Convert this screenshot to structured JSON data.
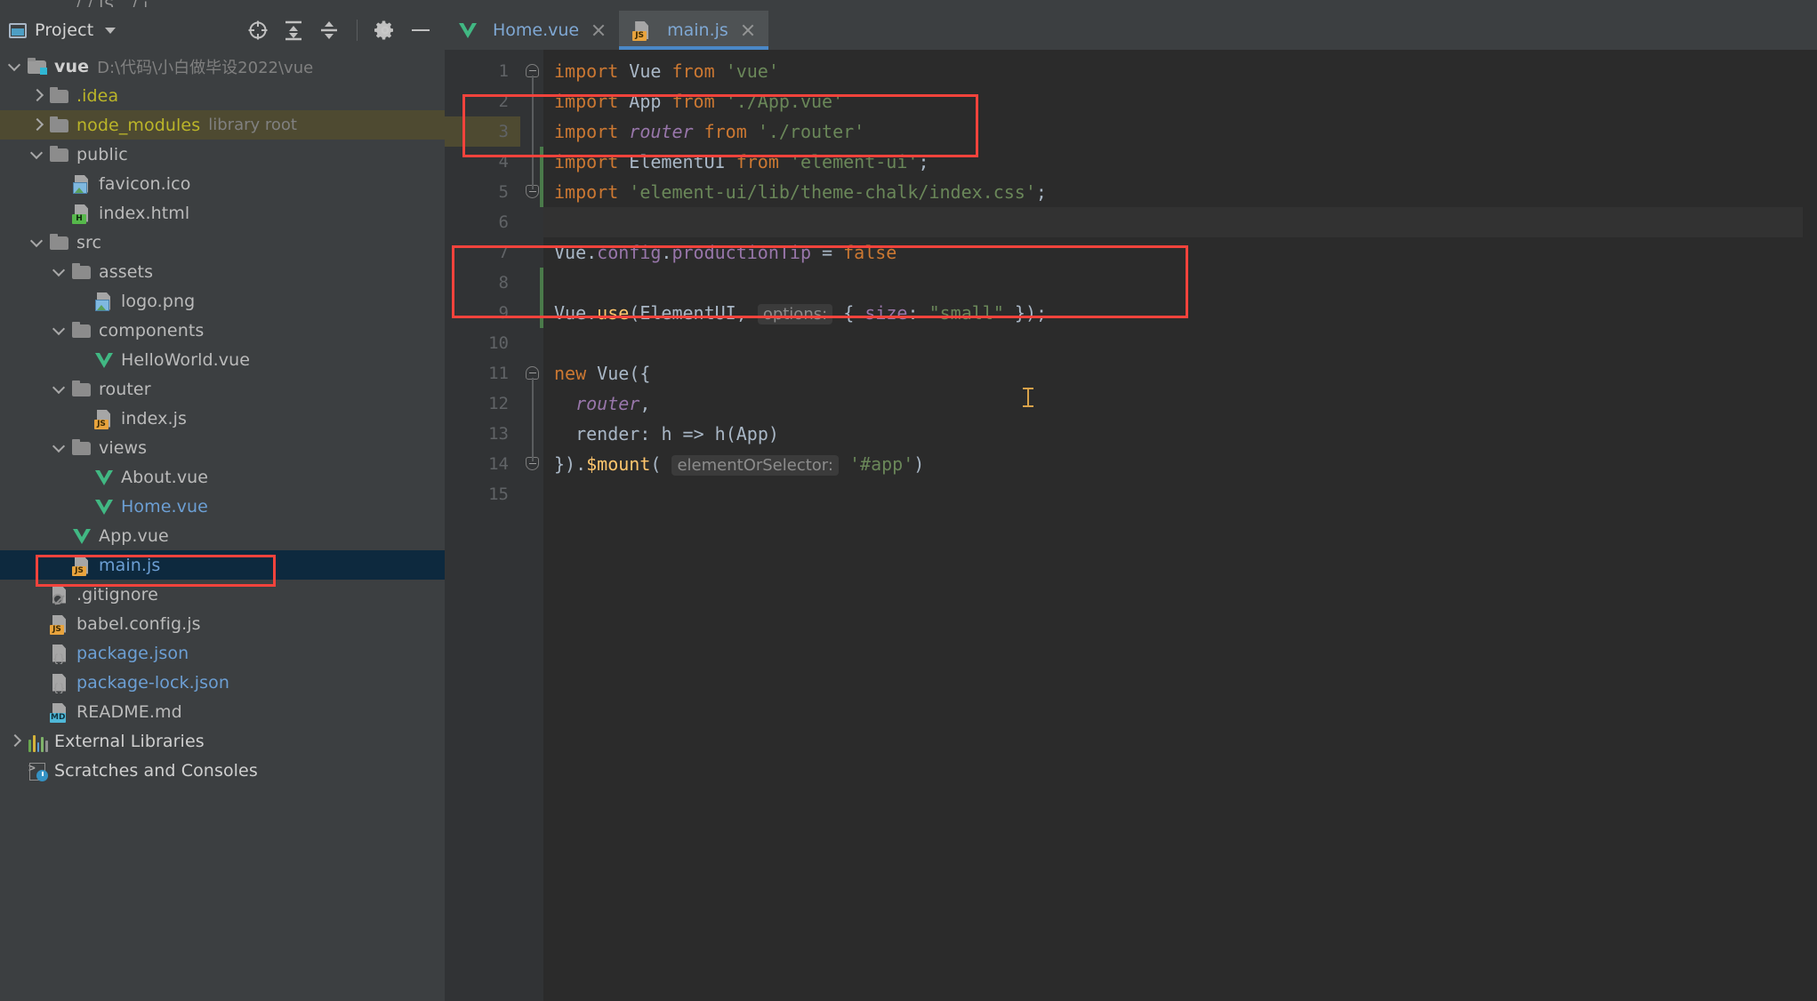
{
  "window": {
    "top_tab_hint": "/    /    JS    .   /   j"
  },
  "sidebar": {
    "panel_title": "Project",
    "icons": {
      "window_icon": "project-window-icon",
      "caret": "chevron-down-icon",
      "locate": "crosshair-target-icon",
      "expand_all": "expand-all-icon",
      "collapse_all": "collapse-all-icon",
      "settings": "gear-icon",
      "hide": "minimize-icon"
    },
    "tree": [
      {
        "label": "vue",
        "secondary": "D:\\代码\\小白做毕设2022\\vue",
        "depth": 0,
        "arrow": "down",
        "icon": "folder-module",
        "color": "white",
        "state": "normal",
        "bold": true
      },
      {
        "label": ".idea",
        "secondary": "",
        "depth": 1,
        "arrow": "right",
        "icon": "folder",
        "color": "yellow",
        "state": "normal",
        "bold": false
      },
      {
        "label": "node_modules",
        "secondary": "library root",
        "depth": 1,
        "arrow": "right",
        "icon": "folder",
        "color": "yellow",
        "state": "olive",
        "bold": false
      },
      {
        "label": "public",
        "secondary": "",
        "depth": 1,
        "arrow": "down",
        "icon": "folder",
        "color": "plain",
        "state": "normal",
        "bold": false
      },
      {
        "label": "favicon.ico",
        "secondary": "",
        "depth": 2,
        "arrow": "none",
        "icon": "image",
        "color": "plain",
        "state": "normal",
        "bold": false
      },
      {
        "label": "index.html",
        "secondary": "",
        "depth": 2,
        "arrow": "none",
        "icon": "html",
        "color": "plain",
        "state": "normal",
        "bold": false
      },
      {
        "label": "src",
        "secondary": "",
        "depth": 1,
        "arrow": "down",
        "icon": "folder",
        "color": "plain",
        "state": "normal",
        "bold": false
      },
      {
        "label": "assets",
        "secondary": "",
        "depth": 2,
        "arrow": "down",
        "icon": "folder",
        "color": "plain",
        "state": "normal",
        "bold": false
      },
      {
        "label": "logo.png",
        "secondary": "",
        "depth": 3,
        "arrow": "none",
        "icon": "image",
        "color": "plain",
        "state": "normal",
        "bold": false
      },
      {
        "label": "components",
        "secondary": "",
        "depth": 2,
        "arrow": "down",
        "icon": "folder",
        "color": "plain",
        "state": "normal",
        "bold": false
      },
      {
        "label": "HelloWorld.vue",
        "secondary": "",
        "depth": 3,
        "arrow": "none",
        "icon": "vue",
        "color": "plain",
        "state": "normal",
        "bold": false
      },
      {
        "label": "router",
        "secondary": "",
        "depth": 2,
        "arrow": "down",
        "icon": "folder",
        "color": "plain",
        "state": "normal",
        "bold": false
      },
      {
        "label": "index.js",
        "secondary": "",
        "depth": 3,
        "arrow": "none",
        "icon": "js",
        "color": "plain",
        "state": "normal",
        "bold": false
      },
      {
        "label": "views",
        "secondary": "",
        "depth": 2,
        "arrow": "down",
        "icon": "folder",
        "color": "plain",
        "state": "normal",
        "bold": false
      },
      {
        "label": "About.vue",
        "secondary": "",
        "depth": 3,
        "arrow": "none",
        "icon": "vue",
        "color": "plain",
        "state": "normal",
        "bold": false
      },
      {
        "label": "Home.vue",
        "secondary": "",
        "depth": 3,
        "arrow": "none",
        "icon": "vue",
        "color": "blue",
        "state": "normal",
        "bold": false
      },
      {
        "label": "App.vue",
        "secondary": "",
        "depth": 2,
        "arrow": "none",
        "icon": "vue",
        "color": "plain",
        "state": "normal",
        "bold": false
      },
      {
        "label": "main.js",
        "secondary": "",
        "depth": 2,
        "arrow": "none",
        "icon": "js",
        "color": "blue",
        "state": "selected",
        "bold": false
      },
      {
        "label": ".gitignore",
        "secondary": "",
        "depth": 1,
        "arrow": "none",
        "icon": "git",
        "color": "plain",
        "state": "normal",
        "bold": false
      },
      {
        "label": "babel.config.js",
        "secondary": "",
        "depth": 1,
        "arrow": "none",
        "icon": "js",
        "color": "plain",
        "state": "normal",
        "bold": false
      },
      {
        "label": "package.json",
        "secondary": "",
        "depth": 1,
        "arrow": "none",
        "icon": "json",
        "color": "blue",
        "state": "normal",
        "bold": false
      },
      {
        "label": "package-lock.json",
        "secondary": "",
        "depth": 1,
        "arrow": "none",
        "icon": "json",
        "color": "blue",
        "state": "normal",
        "bold": false
      },
      {
        "label": "README.md",
        "secondary": "",
        "depth": 1,
        "arrow": "none",
        "icon": "md",
        "color": "plain",
        "state": "normal",
        "bold": false
      },
      {
        "label": "External Libraries",
        "secondary": "",
        "depth": 0,
        "arrow": "right",
        "icon": "lib",
        "color": "white",
        "state": "normal",
        "bold": false
      },
      {
        "label": "Scratches and Consoles",
        "secondary": "",
        "depth": 0,
        "arrow": "none",
        "icon": "scratches",
        "color": "white",
        "state": "normal",
        "bold": false
      }
    ]
  },
  "editor": {
    "tabs": [
      {
        "label": "Home.vue",
        "icon": "vue-file-icon",
        "active": false
      },
      {
        "label": "main.js",
        "icon": "js-file-icon",
        "active": true
      }
    ],
    "line_numbers": [
      "1",
      "2",
      "3",
      "4",
      "5",
      "6",
      "7",
      "8",
      "9",
      "10",
      "11",
      "12",
      "13",
      "14",
      "15"
    ],
    "lines": [
      {
        "n": 1,
        "tokens": [
          {
            "t": "import",
            "c": "k"
          },
          {
            "t": " ",
            "c": "id"
          },
          {
            "t": "Vue",
            "c": "id"
          },
          {
            "t": " ",
            "c": "id"
          },
          {
            "t": "from",
            "c": "k"
          },
          {
            "t": " ",
            "c": "id"
          },
          {
            "t": "'vue'",
            "c": "str"
          }
        ]
      },
      {
        "n": 2,
        "tokens": [
          {
            "t": "import",
            "c": "k"
          },
          {
            "t": " ",
            "c": "id"
          },
          {
            "t": "App",
            "c": "id"
          },
          {
            "t": " ",
            "c": "id"
          },
          {
            "t": "from",
            "c": "k"
          },
          {
            "t": " ",
            "c": "id"
          },
          {
            "t": "'./App.vue'",
            "c": "str"
          }
        ]
      },
      {
        "n": 3,
        "tokens": [
          {
            "t": "import",
            "c": "k"
          },
          {
            "t": " ",
            "c": "id"
          },
          {
            "t": "router",
            "c": "it"
          },
          {
            "t": " ",
            "c": "id"
          },
          {
            "t": "from",
            "c": "k"
          },
          {
            "t": " ",
            "c": "id"
          },
          {
            "t": "'./router'",
            "c": "str"
          }
        ]
      },
      {
        "n": 4,
        "tokens": [
          {
            "t": "import",
            "c": "k"
          },
          {
            "t": " ",
            "c": "id"
          },
          {
            "t": "ElementUI",
            "c": "id"
          },
          {
            "t": " ",
            "c": "id"
          },
          {
            "t": "from",
            "c": "k"
          },
          {
            "t": " ",
            "c": "id"
          },
          {
            "t": "'element-ui'",
            "c": "str"
          },
          {
            "t": ";",
            "c": "id"
          }
        ]
      },
      {
        "n": 5,
        "tokens": [
          {
            "t": "import",
            "c": "k"
          },
          {
            "t": " ",
            "c": "id"
          },
          {
            "t": "'element-ui/lib/theme-chalk/index.css'",
            "c": "str"
          },
          {
            "t": ";",
            "c": "id"
          }
        ]
      },
      {
        "n": 6,
        "tokens": []
      },
      {
        "n": 7,
        "tokens": [
          {
            "t": "Vue",
            "c": "id"
          },
          {
            "t": ".",
            "c": "id"
          },
          {
            "t": "config",
            "c": "prop"
          },
          {
            "t": ".",
            "c": "id"
          },
          {
            "t": "productionTip",
            "c": "prop"
          },
          {
            "t": " = ",
            "c": "id"
          },
          {
            "t": "false",
            "c": "k"
          }
        ]
      },
      {
        "n": 8,
        "tokens": []
      },
      {
        "n": 9,
        "tokens": [
          {
            "t": "Vue",
            "c": "id"
          },
          {
            "t": ".",
            "c": "id"
          },
          {
            "t": "use",
            "c": "fn"
          },
          {
            "t": "(",
            "c": "id"
          },
          {
            "t": "ElementUI",
            "c": "id"
          },
          {
            "t": ", ",
            "c": "id"
          },
          {
            "t": "options:",
            "c": "hint"
          },
          {
            "t": " { ",
            "c": "id"
          },
          {
            "t": "size",
            "c": "prop"
          },
          {
            "t": ": ",
            "c": "id"
          },
          {
            "t": "\"small\"",
            "c": "str"
          },
          {
            "t": " });",
            "c": "id"
          }
        ]
      },
      {
        "n": 10,
        "tokens": []
      },
      {
        "n": 11,
        "tokens": [
          {
            "t": "new",
            "c": "k"
          },
          {
            "t": " ",
            "c": "id"
          },
          {
            "t": "Vue",
            "c": "id"
          },
          {
            "t": "({",
            "c": "id"
          }
        ]
      },
      {
        "n": 12,
        "tokens": [
          {
            "t": "  ",
            "c": "id"
          },
          {
            "t": "router",
            "c": "it"
          },
          {
            "t": ",",
            "c": "id"
          }
        ]
      },
      {
        "n": 13,
        "tokens": [
          {
            "t": "  ",
            "c": "id"
          },
          {
            "t": "render",
            "c": "id"
          },
          {
            "t": ": ",
            "c": "id"
          },
          {
            "t": "h",
            "c": "id"
          },
          {
            "t": " => ",
            "c": "id"
          },
          {
            "t": "h",
            "c": "id"
          },
          {
            "t": "(",
            "c": "id"
          },
          {
            "t": "App",
            "c": "id"
          },
          {
            "t": ")",
            "c": "id"
          }
        ]
      },
      {
        "n": 14,
        "tokens": [
          {
            "t": "}).",
            "c": "id"
          },
          {
            "t": "$mount",
            "c": "fn"
          },
          {
            "t": "(",
            "c": "id"
          },
          {
            "t": " ",
            "c": "id"
          },
          {
            "t": "elementOrSelector:",
            "c": "hint"
          },
          {
            "t": " ",
            "c": "id"
          },
          {
            "t": "'#app'",
            "c": "str"
          },
          {
            "t": ")",
            "c": "id"
          }
        ]
      },
      {
        "n": 15,
        "tokens": []
      }
    ],
    "annotations": {
      "box1_name": "red-highlight-imports",
      "box2_name": "red-highlight-elementui-use",
      "box3_name": "red-highlight-mainjs-file",
      "color": "#f4433c"
    }
  }
}
